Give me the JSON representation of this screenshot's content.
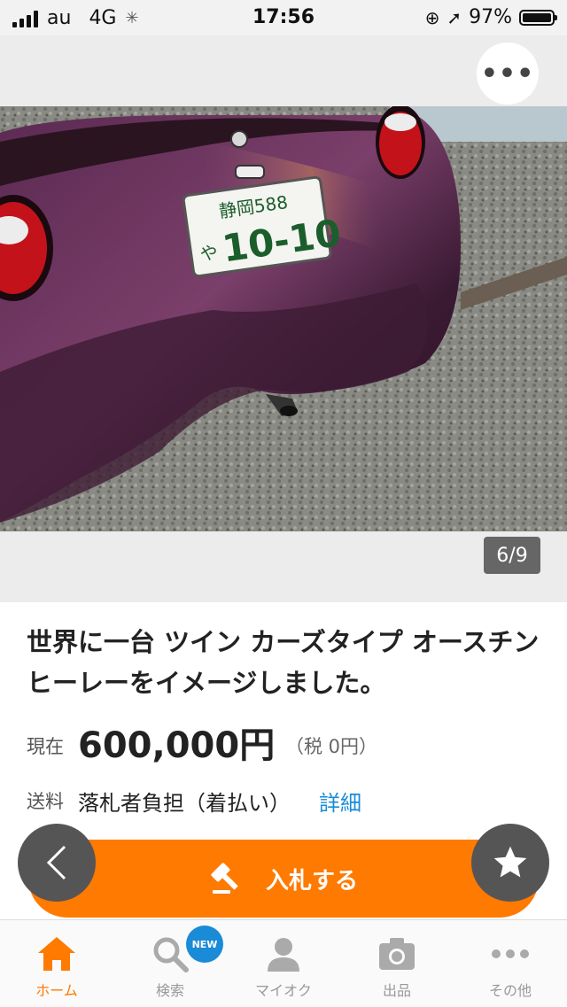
{
  "status_bar": {
    "carrier": "au",
    "network": "4G",
    "time": "17:56",
    "battery": "97%"
  },
  "photo": {
    "counter": "6/9",
    "more_label": "•••",
    "plate_top": "静岡588",
    "plate_kana": "や",
    "plate_number": "10-10"
  },
  "item": {
    "title": "世界に一台 ツイン カーズタイプ オースチンヒーレーをイメージしました。",
    "price_label": "現在",
    "price_value": "600,000円",
    "price_tax": "（税 0円）",
    "shipping_label": "送料",
    "shipping_value": "落札者負担（着払い）",
    "shipping_detail": "詳細"
  },
  "actions": {
    "bid_label": "入札する"
  },
  "tabs": [
    {
      "label": "ホーム",
      "icon": "home-icon",
      "active": true
    },
    {
      "label": "検索",
      "icon": "search-icon",
      "badge": "NEW"
    },
    {
      "label": "マイオク",
      "icon": "user-icon"
    },
    {
      "label": "出品",
      "icon": "camera-icon"
    },
    {
      "label": "その他",
      "icon": "more-icon"
    }
  ],
  "colors": {
    "accent": "#ff7a00",
    "link": "#1a8bd6",
    "car_body": "#4a2340"
  }
}
